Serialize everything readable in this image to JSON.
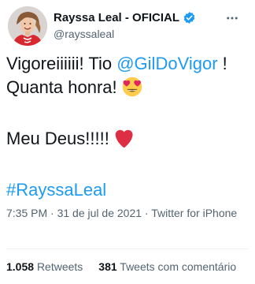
{
  "author": {
    "display_name": "Rayssa Leal - OFICIAL",
    "handle": "@rayssaleal",
    "verified": true
  },
  "tweet": {
    "line1_text": "Vigoreiiiiii! Tio ",
    "line1_mention": "@GilDoVigor",
    "line1_suffix": " !",
    "line2_text": "Quanta honra! ",
    "line3_text": "Meu Deus!!!!! ",
    "hashtag": "#RayssaLeal",
    "emojis": [
      "heart-eyes-icon",
      "red-heart-icon"
    ]
  },
  "meta": {
    "time": "7:35 PM",
    "separator1": " · ",
    "date": "31 de jul de 2021",
    "separator2": " · ",
    "source": "Twitter for iPhone"
  },
  "stats": {
    "retweets_count": "1.058",
    "retweets_label": "Retweets",
    "quotes_count": "381",
    "quotes_label": "Tweets com comentário"
  },
  "colors": {
    "link": "#1d9bf0",
    "text": "#0f1419",
    "muted": "#536471",
    "heart": "#e0245e",
    "jersey": "#d7272f"
  }
}
